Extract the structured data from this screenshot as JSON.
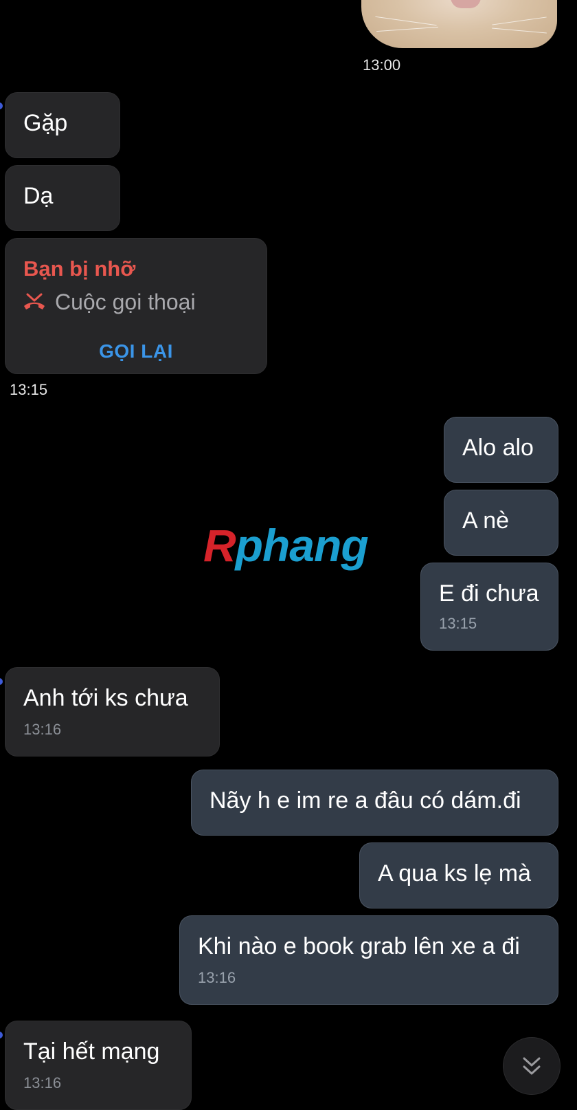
{
  "messages": {
    "sticker_time": "13:00",
    "gap": "Gặp",
    "da": "Dạ",
    "missed_call": {
      "title": "Bạn bị nhỡ",
      "subtitle": "Cuộc gọi thoại",
      "action": "GỌI LẠI",
      "time": "13:15"
    },
    "alo": "Alo alo",
    "a_ne": "A nè",
    "e_di_chua": {
      "text": "E đi chưa",
      "time": "13:15"
    },
    "anh_toi": {
      "text": "Anh tới ks chưa",
      "time": "13:16"
    },
    "nay_h": "Nãy h e im re a đâu có dám.đi",
    "a_qua": "A qua ks lẹ mà",
    "khi_nao": {
      "text": "Khi nào e book grab lên xe a đi",
      "time": "13:16"
    },
    "tai_het": {
      "text": "Tại hết mạng",
      "time": "13:16"
    }
  },
  "watermark": {
    "first": "R",
    "rest": "phang"
  },
  "icons": {
    "missed_call": "missed-call-icon",
    "scroll_down": "chevron-double-down-icon"
  },
  "colors": {
    "background": "#000000",
    "incoming_bubble": "#262628",
    "outgoing_bubble": "#333c48",
    "missed_red": "#e8574f",
    "callback_blue": "#3b95e8"
  }
}
